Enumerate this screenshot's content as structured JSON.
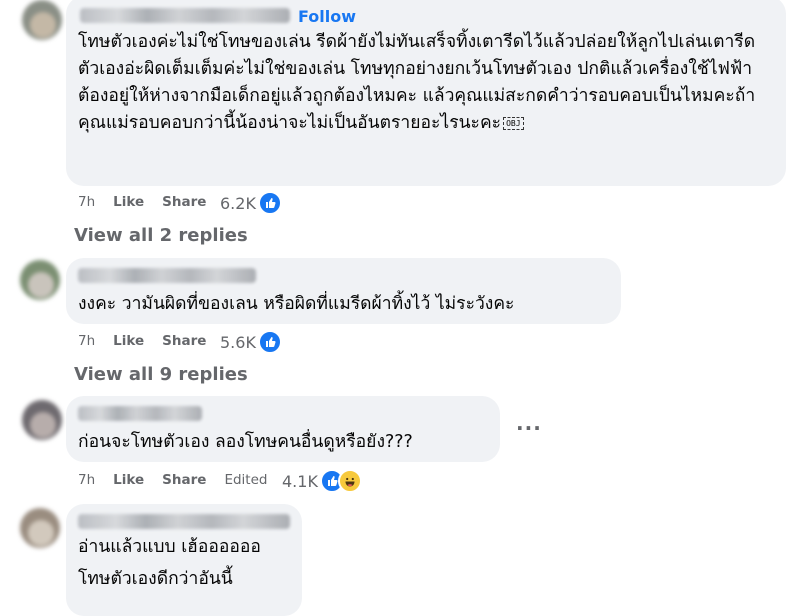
{
  "comments": [
    {
      "follow_label": "Follow",
      "text": "โทษตัวเองค่ะไม่ใช่โทษของเล่น รีดผ้ายังไม่ทันเสร็จทิ้งเตารีดไว้แล้วปล่อยให้ลูกไปเล่นเตารีด ตัวเองอ่ะผิดเต็มเต็มค่ะไม่ใช่ของเล่น โทษทุกอย่างยกเว้นโทษตัวเอง ปกติแล้วเครื่องใช้ไฟฟ้าต้องอยู่ให้ห่างจากมือเด็กอยู่แล้วถูกต้องไหมคะ แล้วคุณแม่สะกดคำว่ารอบคอบเป็นไหมคะถ้าคุณแม่รอบคอบกว่านี้น้องน่าจะไม่เป็นอันตรายอะไรนะคะ",
      "obj_glyph": "OBJ",
      "time": "7h",
      "like_label": "Like",
      "share_label": "Share",
      "reaction_count": "6.2K",
      "view_replies": "View all 2 replies"
    },
    {
      "text": "งงคะ วามันผิดที่ของเลน หรือผิดที่แมรีดผ้าทิ้งไว้ ไม่ระวังคะ",
      "time": "7h",
      "like_label": "Like",
      "share_label": "Share",
      "reaction_count": "5.6K",
      "view_replies": "View all 9 replies"
    },
    {
      "text": "ก่อนจะโทษตัวเอง ลองโทษคนอื่นดูหรือยัง???",
      "time": "7h",
      "like_label": "Like",
      "share_label": "Share",
      "edited_label": "Edited",
      "reaction_count": "4.1K",
      "more_label": "···"
    },
    {
      "line1": "อ่านแล้วแบบ เฮ้ออออออ",
      "line2": "โทษตัวเองดีกว่าอันนี้"
    }
  ],
  "colors": {
    "link_blue": "#1877f2",
    "bubble_bg": "#f0f2f5",
    "meta_gray": "#65676b"
  },
  "icons": [
    "like-reaction-icon",
    "haha-reaction-icon",
    "more-options-icon"
  ]
}
